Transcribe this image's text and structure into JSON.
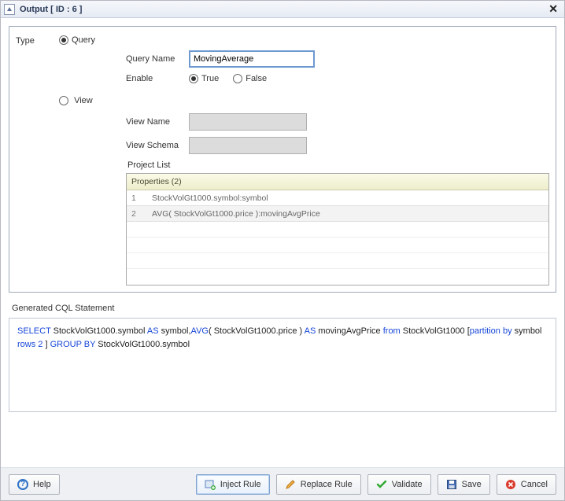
{
  "title": "Output [ ID : 6 ]",
  "type_label": "Type",
  "type_options": {
    "query": "Query",
    "view": "View"
  },
  "query": {
    "name_label": "Query Name",
    "name_value": "MovingAverage",
    "enable_label": "Enable",
    "enable_true": "True",
    "enable_false": "False"
  },
  "view": {
    "name_label": "View Name",
    "schema_label": "View Schema",
    "name_value": "",
    "schema_value": ""
  },
  "project_list": {
    "label": "Project List",
    "header": "Properties (2)",
    "rows": [
      {
        "n": "1",
        "text": "StockVolGt1000.symbol:symbol"
      },
      {
        "n": "2",
        "text": "AVG( StockVolGt1000.price ):movingAvgPrice"
      }
    ]
  },
  "cql": {
    "label": "Generated CQL Statement",
    "tokens": [
      {
        "t": "SELECT",
        "k": true
      },
      {
        "t": " StockVolGt1000.symbol ",
        "k": false
      },
      {
        "t": "AS",
        "k": true
      },
      {
        "t": " symbol,",
        "k": false
      },
      {
        "t": "AVG",
        "k": true
      },
      {
        "t": "( StockVolGt1000.price ) ",
        "k": false
      },
      {
        "t": "AS",
        "k": true
      },
      {
        "t": " movingAvgPrice ",
        "k": false
      },
      {
        "t": "from",
        "k": true
      },
      {
        "t": "  StockVolGt1000  [",
        "k": false
      },
      {
        "t": "partition by",
        "k": true
      },
      {
        "t": "  symbol  ",
        "k": false
      },
      {
        "t": "rows 2",
        "k": true
      },
      {
        "t": " ] ",
        "k": false
      },
      {
        "t": "GROUP BY",
        "k": true
      },
      {
        "t": " StockVolGt1000.symbol",
        "k": false
      }
    ]
  },
  "buttons": {
    "help": "Help",
    "inject": "Inject Rule",
    "replace": "Replace Rule",
    "validate": "Validate",
    "save": "Save",
    "cancel": "Cancel"
  }
}
